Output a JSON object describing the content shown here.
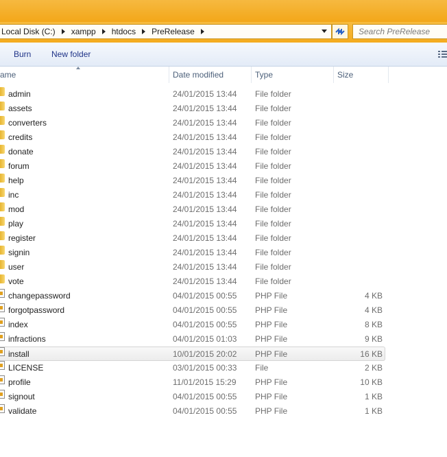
{
  "address": {
    "breadcrumbs": [
      "Local Disk (C:)",
      "xampp",
      "htdocs",
      "PreRelease"
    ],
    "search_placeholder": "Search PreRelease"
  },
  "toolbar": {
    "burn_label": "Burn",
    "new_folder_label": "New folder"
  },
  "columns": {
    "name": "ame",
    "date": "Date modified",
    "type": "Type",
    "size": "Size"
  },
  "files": [
    {
      "name": "admin",
      "date": "24/01/2015 13:44",
      "type": "File folder",
      "size": "",
      "kind": "folder"
    },
    {
      "name": "assets",
      "date": "24/01/2015 13:44",
      "type": "File folder",
      "size": "",
      "kind": "folder"
    },
    {
      "name": "converters",
      "date": "24/01/2015 13:44",
      "type": "File folder",
      "size": "",
      "kind": "folder"
    },
    {
      "name": "credits",
      "date": "24/01/2015 13:44",
      "type": "File folder",
      "size": "",
      "kind": "folder"
    },
    {
      "name": "donate",
      "date": "24/01/2015 13:44",
      "type": "File folder",
      "size": "",
      "kind": "folder"
    },
    {
      "name": "forum",
      "date": "24/01/2015 13:44",
      "type": "File folder",
      "size": "",
      "kind": "folder"
    },
    {
      "name": "help",
      "date": "24/01/2015 13:44",
      "type": "File folder",
      "size": "",
      "kind": "folder"
    },
    {
      "name": "inc",
      "date": "24/01/2015 13:44",
      "type": "File folder",
      "size": "",
      "kind": "folder"
    },
    {
      "name": "mod",
      "date": "24/01/2015 13:44",
      "type": "File folder",
      "size": "",
      "kind": "folder"
    },
    {
      "name": "play",
      "date": "24/01/2015 13:44",
      "type": "File folder",
      "size": "",
      "kind": "folder"
    },
    {
      "name": "register",
      "date": "24/01/2015 13:44",
      "type": "File folder",
      "size": "",
      "kind": "folder"
    },
    {
      "name": "signin",
      "date": "24/01/2015 13:44",
      "type": "File folder",
      "size": "",
      "kind": "folder"
    },
    {
      "name": "user",
      "date": "24/01/2015 13:44",
      "type": "File folder",
      "size": "",
      "kind": "folder"
    },
    {
      "name": "vote",
      "date": "24/01/2015 13:44",
      "type": "File folder",
      "size": "",
      "kind": "folder"
    },
    {
      "name": "changepassword",
      "date": "04/01/2015 00:55",
      "type": "PHP File",
      "size": "4 KB",
      "kind": "file"
    },
    {
      "name": "forgotpassword",
      "date": "04/01/2015 00:55",
      "type": "PHP File",
      "size": "4 KB",
      "kind": "file"
    },
    {
      "name": "index",
      "date": "04/01/2015 00:55",
      "type": "PHP File",
      "size": "8 KB",
      "kind": "file"
    },
    {
      "name": "infractions",
      "date": "04/01/2015 01:03",
      "type": "PHP File",
      "size": "9 KB",
      "kind": "file"
    },
    {
      "name": "install",
      "date": "10/01/2015 20:02",
      "type": "PHP File",
      "size": "16 KB",
      "kind": "file",
      "selected": true
    },
    {
      "name": "LICENSE",
      "date": "03/01/2015 00:33",
      "type": "File",
      "size": "2 KB",
      "kind": "file"
    },
    {
      "name": "profile",
      "date": "11/01/2015 15:29",
      "type": "PHP File",
      "size": "10 KB",
      "kind": "file"
    },
    {
      "name": "signout",
      "date": "04/01/2015 00:55",
      "type": "PHP File",
      "size": "1 KB",
      "kind": "file"
    },
    {
      "name": "validate",
      "date": "04/01/2015 00:55",
      "type": "PHP File",
      "size": "1 KB",
      "kind": "file"
    }
  ]
}
